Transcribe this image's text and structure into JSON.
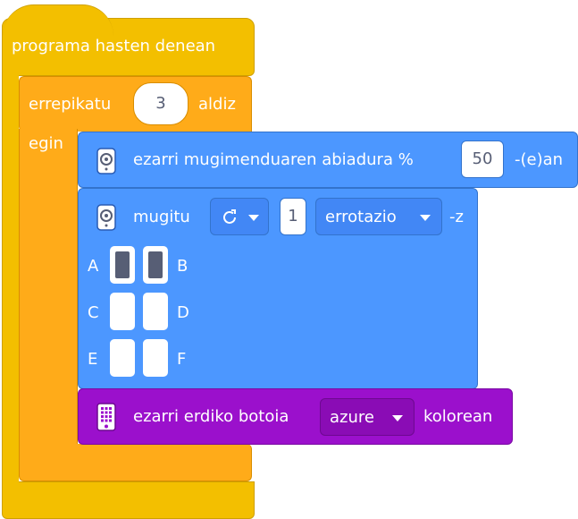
{
  "hat": {
    "label": "programa hasten denean"
  },
  "repeat": {
    "label_prefix": "errepikatu",
    "count": "3",
    "label_suffix": "aldiz",
    "do_label": "egin"
  },
  "speed": {
    "icon": "motor-icon",
    "label": "ezarri mugimenduaren abiadura %",
    "value": "50",
    "suffix": "-(e)an"
  },
  "move": {
    "icon": "motor-icon",
    "label": "mugitu",
    "direction_icon": "rotate-clockwise-icon",
    "amount": "1",
    "unit": "errotazio",
    "suffix": "-z",
    "ports": [
      {
        "name": "A",
        "selected": true
      },
      {
        "name": "B",
        "selected": true
      },
      {
        "name": "C",
        "selected": false
      },
      {
        "name": "D",
        "selected": false
      },
      {
        "name": "E",
        "selected": false
      },
      {
        "name": "F",
        "selected": false
      }
    ]
  },
  "light": {
    "icon": "hub-icon",
    "label": "ezarri erdiko botoia",
    "color": "azure",
    "suffix": "kolorean"
  },
  "colors": {
    "events": "#f3bf00",
    "control": "#ffab19",
    "motors": "#4c97ff",
    "light": "#9b10cc"
  }
}
